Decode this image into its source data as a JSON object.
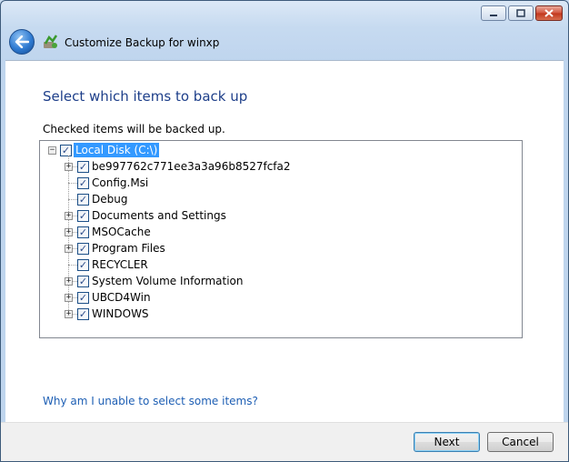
{
  "window": {
    "title": "Customize Backup for winxp",
    "caption_buttons": [
      "minimize",
      "maximize",
      "close"
    ]
  },
  "page": {
    "heading": "Select which items to back up",
    "instruction": "Checked items will be backed up."
  },
  "tree": {
    "root": {
      "label": "Local Disk (C:\\)",
      "checked": true,
      "expanded": true,
      "selected": true
    },
    "items": [
      {
        "label": "be997762c771ee3a3a96b8527fcfa2",
        "checked": true,
        "has_children": true
      },
      {
        "label": "Config.Msi",
        "checked": true,
        "has_children": false
      },
      {
        "label": "Debug",
        "checked": true,
        "has_children": false
      },
      {
        "label": "Documents and Settings",
        "checked": true,
        "has_children": true
      },
      {
        "label": "MSOCache",
        "checked": true,
        "has_children": true
      },
      {
        "label": "Program Files",
        "checked": true,
        "has_children": true
      },
      {
        "label": "RECYCLER",
        "checked": true,
        "has_children": false
      },
      {
        "label": "System Volume Information",
        "checked": true,
        "has_children": true
      },
      {
        "label": "UBCD4Win",
        "checked": true,
        "has_children": true
      },
      {
        "label": "WINDOWS",
        "checked": true,
        "has_children": true
      }
    ]
  },
  "help_link": "Why am I unable to select some items?",
  "buttons": {
    "next": "Next",
    "cancel": "Cancel"
  },
  "colors": {
    "heading": "#1e3f8a",
    "link": "#1e5fb4",
    "selection": "#3399ff"
  }
}
